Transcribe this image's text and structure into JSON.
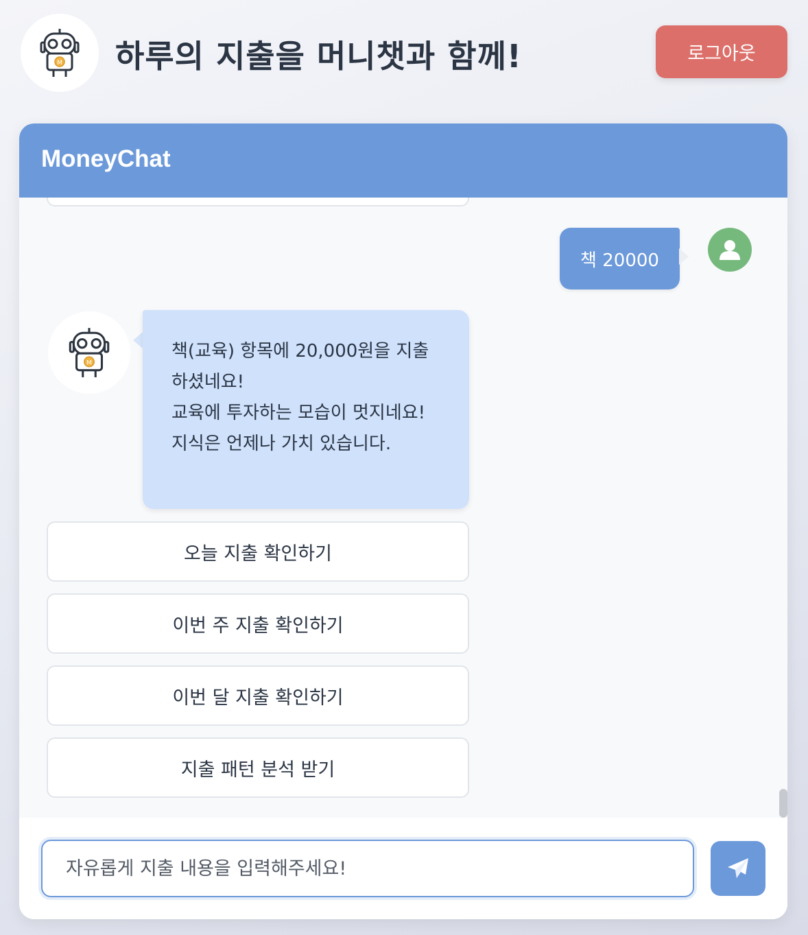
{
  "header": {
    "title": "하루의 지출을 머니챗과 함께!",
    "logout_label": "로그아웃",
    "logo_icon": "robot-mascot-icon"
  },
  "chat": {
    "title": "MoneyChat",
    "user_message": "책 20000",
    "bot_message": [
      "책(교육) 항목에 20,000원을 지출하셨네요!",
      "교육에 투자하는 모습이 멋지네요! 지식은 언제나 가치 있습니다."
    ],
    "quick_replies": [
      "오늘 지출 확인하기",
      "이번 주 지출 확인하기",
      "이번 달 지출 확인하기",
      "지출 패턴 분석 받기"
    ]
  },
  "input": {
    "placeholder": "자유롭게 지출 내용을 입력해주세요!",
    "send_icon": "paper-plane-icon"
  },
  "colors": {
    "accent": "#6c99da",
    "logout": "#dc6f69",
    "bot_bubble": "#cfe1fb",
    "user_avatar": "#76b97d",
    "text": "#2b3544"
  }
}
